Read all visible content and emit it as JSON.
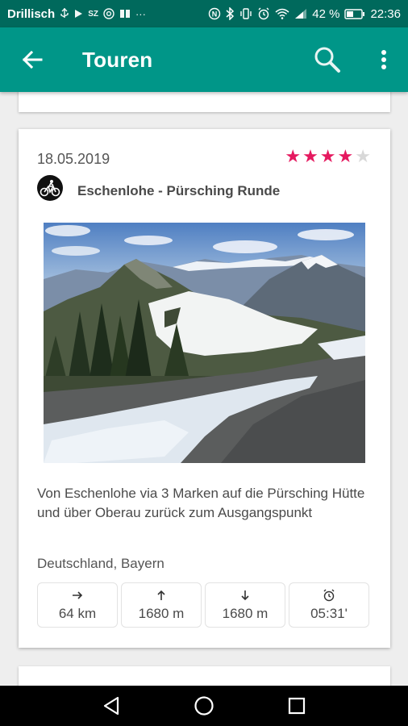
{
  "status_bar": {
    "carrier": "Drillisch",
    "notification_icons": [
      "usb-icon",
      "play-icon",
      "sz-icon",
      "at-icon",
      "book-icon",
      "more-dots-icon"
    ],
    "battery_percent": "42 %",
    "time": "22:36"
  },
  "app_bar": {
    "title": "Touren",
    "color": "#009688",
    "status_color": "#00695c"
  },
  "tour": {
    "date": "18.05.2019",
    "rating": 4,
    "rating_max": 5,
    "activity": "bike-icon",
    "title": "Eschenlohe - Pürsching Runde",
    "description": "Von Eschenlohe via 3 Marken auf die Pürsching Hütte und über Oberau zurück zum Ausgangspunkt",
    "location": "Deutschland, Bayern",
    "stats": [
      {
        "icon": "arrow-right-icon",
        "value": "64 km"
      },
      {
        "icon": "arrow-up-icon",
        "value": "1680 m"
      },
      {
        "icon": "arrow-down-icon",
        "value": "1680 m"
      },
      {
        "icon": "alarm-clock-icon",
        "value": "05:31'"
      }
    ]
  },
  "accent_color": "#e5195f"
}
